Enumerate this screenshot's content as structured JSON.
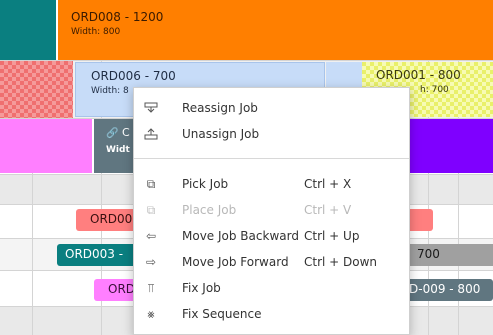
{
  "jobs": {
    "ord008": {
      "title": "ORD008 - 1200",
      "width_label": "Width: 800"
    },
    "ord006": {
      "title": "ORD006 - 700",
      "width_label": "Width: 8"
    },
    "ord001": {
      "title": "ORD001 - 800",
      "width_label": "h: 700"
    },
    "ord_c": {
      "title": "C",
      "width_label": "Widt"
    },
    "ord00_red": {
      "title": "ORD00"
    },
    "ord003": {
      "title": "ORD003 -"
    },
    "right_700": {
      "title": "700"
    },
    "ord_pink": {
      "title": "ORD"
    },
    "ord009": {
      "title": "D-009 - 800"
    }
  },
  "context_menu": {
    "items": [
      {
        "label": "Reassign Job",
        "icon": "reassign-icon",
        "shortcut": ""
      },
      {
        "label": "Unassign Job",
        "icon": "unassign-icon",
        "shortcut": ""
      },
      {
        "label": "Pick Job",
        "icon": "pick-icon",
        "shortcut": "Ctrl + X"
      },
      {
        "label": "Place Job",
        "icon": "place-icon",
        "shortcut": "Ctrl + V",
        "disabled": true
      },
      {
        "label": "Move Job Backward",
        "icon": "move-backward-icon",
        "shortcut": "Ctrl + Up"
      },
      {
        "label": "Move Job Forward",
        "icon": "move-forward-icon",
        "shortcut": "Ctrl + Down"
      },
      {
        "label": "Fix Job",
        "icon": "pin-icon",
        "shortcut": ""
      },
      {
        "label": "Fix Sequence",
        "icon": "fix-sequence-icon",
        "shortcut": ""
      }
    ]
  },
  "colors": {
    "orange": "#ff7f00",
    "teal": "#0a7f80",
    "light_blue": "#c7dcf8",
    "magenta": "#ff7fff",
    "purple": "#7f00ff",
    "slate": "#607680",
    "salmon": "#ff7f7f",
    "grey_bar": "#a0a0a0"
  }
}
